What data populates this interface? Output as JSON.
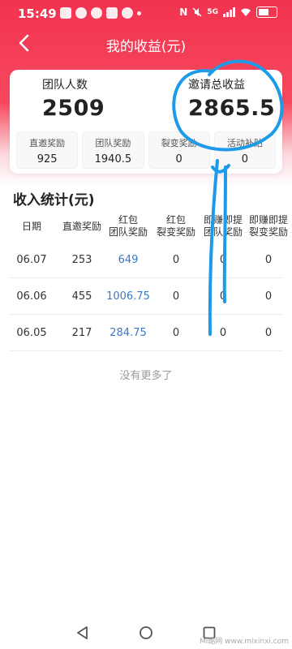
{
  "status_bar": {
    "time": "15:49",
    "left_icons": [
      "notification-icon",
      "penguin-icon",
      "wechat-icon",
      "app-icon",
      "chat-icon",
      "dot-icon"
    ],
    "right_icons": [
      "nfc-icon",
      "mute-icon",
      "signal-icon",
      "wifi-icon",
      "battery-icon"
    ],
    "nfc_text": "N",
    "signal_text": "5G"
  },
  "nav": {
    "back_icon": "chevron-left-icon",
    "title": "我的收益(元)"
  },
  "summary": {
    "team_count_label": "团队人数",
    "team_count_value": "2509",
    "invite_total_label": "邀请总收益",
    "invite_total_value": "2865.5",
    "mini_stats": [
      {
        "label": "直邀奖励",
        "value": "925"
      },
      {
        "label": "团队奖励",
        "value": "1940.5"
      },
      {
        "label": "裂变奖励",
        "value": "0"
      },
      {
        "label": "活动补贴",
        "value": "0"
      }
    ]
  },
  "income": {
    "title": "收入统计(元)",
    "columns": [
      {
        "line1": "日期",
        "line2": ""
      },
      {
        "line1": "直邀奖励",
        "line2": ""
      },
      {
        "line1": "红包",
        "line2": "团队奖励"
      },
      {
        "line1": "红包",
        "line2": "裂变奖励"
      },
      {
        "line1": "即赚即提",
        "line2": "团队奖励"
      },
      {
        "line1": "即赚即提",
        "line2": "裂变奖励"
      }
    ],
    "rows": [
      {
        "date": "06.07",
        "direct": "253",
        "team": "649",
        "fission": "0",
        "instant_team": "0",
        "instant_fission": "0"
      },
      {
        "date": "06.06",
        "direct": "455",
        "team": "1006.75",
        "fission": "0",
        "instant_team": "0",
        "instant_fission": "0"
      },
      {
        "date": "06.05",
        "direct": "217",
        "team": "284.75",
        "fission": "0",
        "instant_team": "0",
        "instant_fission": "0"
      }
    ],
    "no_more": "没有更多了"
  },
  "system_nav": {
    "back_icon": "triangle-back-icon",
    "home_icon": "circle-home-icon",
    "recents_icon": "square-recents-icon"
  },
  "watermark": "Mi酷网 www.mixinxi.com",
  "colors": {
    "brand": "#f2334f",
    "link_blue": "#3b78c7",
    "annotation_blue": "#1e9be8"
  }
}
